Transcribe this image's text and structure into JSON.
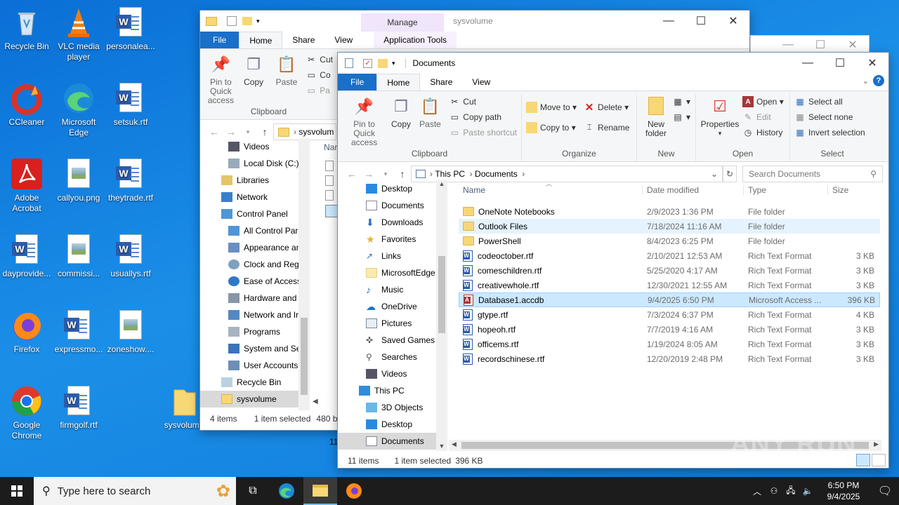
{
  "desktop": {
    "icons": [
      {
        "label": "Recycle Bin"
      },
      {
        "label": "VLC media player"
      },
      {
        "label": "personalea..."
      },
      {
        "label": "CCleaner"
      },
      {
        "label": "Microsoft Edge"
      },
      {
        "label": "setsuk.rtf"
      },
      {
        "label": "Adobe Acrobat"
      },
      {
        "label": "callyou.png"
      },
      {
        "label": "theytrade.rtf"
      },
      {
        "label": "dayprovide..."
      },
      {
        "label": "commissi..."
      },
      {
        "label": "usuallys.rtf"
      },
      {
        "label": "Firefox"
      },
      {
        "label": "expressmo..."
      },
      {
        "label": "zoneshow...."
      },
      {
        "label": "Google Chrome"
      },
      {
        "label": "firmgolf.rtf"
      },
      {
        "label": "sysvolume"
      }
    ]
  },
  "back_window": {
    "title": "sysvolume",
    "context_tab": "Manage",
    "context_sub": "Application Tools",
    "tabs": [
      "File",
      "Home",
      "Share",
      "View"
    ],
    "ribbon": {
      "pin": "Pin to Quick access",
      "copy": "Copy",
      "paste": "Paste",
      "cut": "Cut",
      "copy_path": "Co",
      "paste_short": "Pa",
      "group": "Clipboard"
    },
    "address": "sysvolum",
    "nav": [
      {
        "label": "Videos"
      },
      {
        "label": "Local Disk (C:)"
      },
      {
        "label": "Libraries"
      },
      {
        "label": "Network"
      },
      {
        "label": "Control Panel"
      },
      {
        "label": "All Control Par"
      },
      {
        "label": "Appearance an"
      },
      {
        "label": "Clock and Regi"
      },
      {
        "label": "Ease of Access"
      },
      {
        "label": "Hardware and"
      },
      {
        "label": "Network and Ir"
      },
      {
        "label": "Programs"
      },
      {
        "label": "System and Se"
      },
      {
        "label": "User Accounts"
      },
      {
        "label": "Recycle Bin"
      },
      {
        "label": "sysvolume"
      }
    ],
    "col_name": "Nar",
    "status_items": "4 items",
    "status_sel": "1 item selected",
    "status_size": "480 byt",
    "extra_row": "11"
  },
  "front_window": {
    "title": "Documents",
    "tabs": [
      "File",
      "Home",
      "Share",
      "View"
    ],
    "ribbon": {
      "pin": "Pin to Quick access",
      "copy": "Copy",
      "paste": "Paste",
      "cut": "Cut",
      "copy_path": "Copy path",
      "paste_shortcut": "Paste shortcut",
      "clipboard": "Clipboard",
      "move_to": "Move to",
      "copy_to": "Copy to",
      "delete": "Delete",
      "rename": "Rename",
      "organize": "Organize",
      "new_folder": "New folder",
      "new": "New",
      "properties": "Properties",
      "open": "Open",
      "edit": "Edit",
      "history": "History",
      "open_group": "Open",
      "select_all": "Select all",
      "select_none": "Select none",
      "invert": "Invert selection",
      "select_group": "Select"
    },
    "breadcrumb": [
      "This PC",
      "Documents"
    ],
    "search_placeholder": "Search Documents",
    "nav": [
      {
        "label": "Desktop"
      },
      {
        "label": "Documents"
      },
      {
        "label": "Downloads"
      },
      {
        "label": "Favorites"
      },
      {
        "label": "Links"
      },
      {
        "label": "MicrosoftEdge"
      },
      {
        "label": "Music"
      },
      {
        "label": "OneDrive"
      },
      {
        "label": "Pictures"
      },
      {
        "label": "Saved Games"
      },
      {
        "label": "Searches"
      },
      {
        "label": "Videos"
      },
      {
        "label": "This PC"
      },
      {
        "label": "3D Objects"
      },
      {
        "label": "Desktop"
      },
      {
        "label": "Documents"
      }
    ],
    "columns": {
      "name": "Name",
      "date": "Date modified",
      "type": "Type",
      "size": "Size"
    },
    "files": [
      {
        "name": "OneNote Notebooks",
        "date": "2/9/2023 1:36 PM",
        "type": "File folder",
        "size": "",
        "icon": "folder"
      },
      {
        "name": "Outlook Files",
        "date": "7/18/2024 11:16 AM",
        "type": "File folder",
        "size": "",
        "icon": "folder"
      },
      {
        "name": "PowerShell",
        "date": "8/4/2023 6:25 PM",
        "type": "File folder",
        "size": "",
        "icon": "folder"
      },
      {
        "name": "codeoctober.rtf",
        "date": "2/10/2021 12:53 AM",
        "type": "Rich Text Format",
        "size": "3 KB",
        "icon": "rtf"
      },
      {
        "name": "comeschildren.rtf",
        "date": "5/25/2020 4:17 AM",
        "type": "Rich Text Format",
        "size": "3 KB",
        "icon": "rtf"
      },
      {
        "name": "creativewhole.rtf",
        "date": "12/30/2021 12:55 AM",
        "type": "Rich Text Format",
        "size": "3 KB",
        "icon": "rtf"
      },
      {
        "name": "Database1.accdb",
        "date": "9/4/2025 6:50 PM",
        "type": "Microsoft Access ...",
        "size": "396 KB",
        "icon": "access"
      },
      {
        "name": "gtype.rtf",
        "date": "7/3/2024 6:37 PM",
        "type": "Rich Text Format",
        "size": "4 KB",
        "icon": "rtf"
      },
      {
        "name": "hopeoh.rtf",
        "date": "7/7/2019 4:16 AM",
        "type": "Rich Text Format",
        "size": "3 KB",
        "icon": "rtf"
      },
      {
        "name": "officems.rtf",
        "date": "1/19/2024 8:05 AM",
        "type": "Rich Text Format",
        "size": "3 KB",
        "icon": "rtf"
      },
      {
        "name": "recordschinese.rtf",
        "date": "12/20/2019 2:48 PM",
        "type": "Rich Text Format",
        "size": "3 KB",
        "icon": "rtf"
      }
    ],
    "status_items": "11 items",
    "status_sel": "1 item selected",
    "status_size": "396 KB"
  },
  "taskbar": {
    "search_placeholder": "Type here to search",
    "time": "6:50 PM",
    "date": "9/4/2025"
  },
  "watermark": "ANY RUN"
}
